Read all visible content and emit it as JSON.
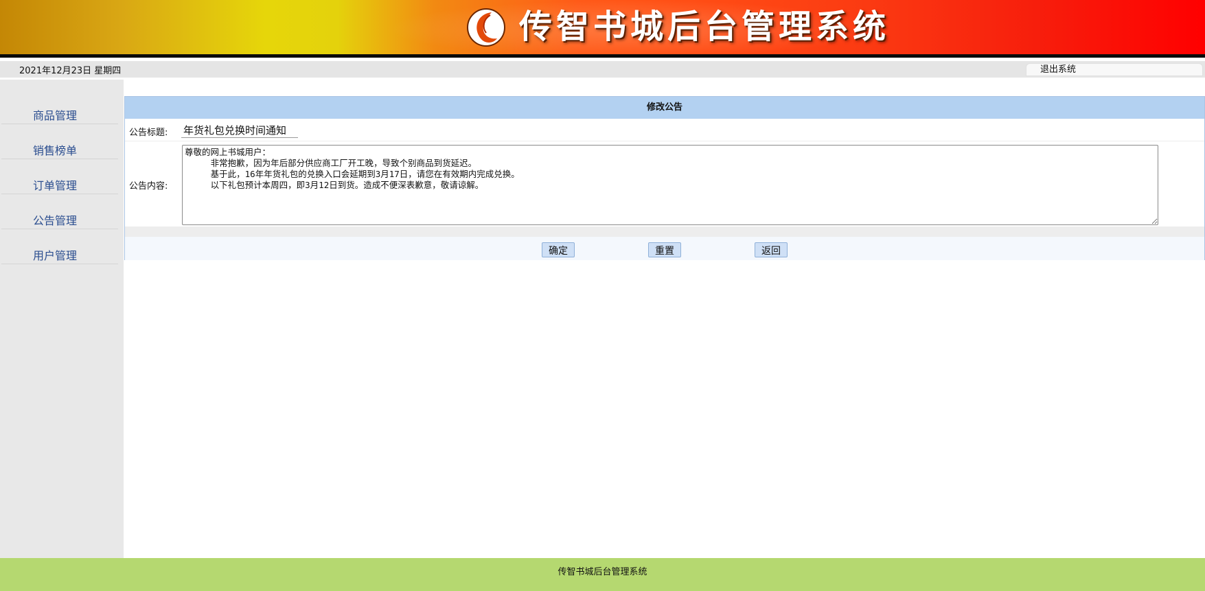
{
  "banner": {
    "title": "传智书城后台管理系统",
    "logo_icon": "swoosh-logo-icon"
  },
  "topbar": {
    "date": "2021年12月23日 星期四",
    "logout_label": "退出系统"
  },
  "sidebar": {
    "items": [
      {
        "label": "商品管理"
      },
      {
        "label": "销售榜单"
      },
      {
        "label": "订单管理"
      },
      {
        "label": "公告管理"
      },
      {
        "label": "用户管理"
      }
    ]
  },
  "form": {
    "header": "修改公告",
    "title_label": "公告标题:",
    "title_value": "年货礼包兑换时间通知",
    "content_label": "公告内容:",
    "content_value": "尊敬的网上书城用户：\n     非常抱歉，因为年后部分供应商工厂开工晚，导致个别商品到货延迟。\n     基于此，16年年货礼包的兑换入口会延期到3月17日，请您在有效期内完成兑换。\n     以下礼包预计本周四，即3月12日到货。造成不便深表歉意，敬请谅解。",
    "confirm_label": "确定",
    "reset_label": "重置",
    "back_label": "返回"
  },
  "footer": {
    "text": "传智书城后台管理系统"
  },
  "colors": {
    "header_blue": "#b3d1f1",
    "footer_green": "#b5d870",
    "nav_text": "#2a4d8f",
    "sidebar_bg": "#e8e8e8"
  }
}
